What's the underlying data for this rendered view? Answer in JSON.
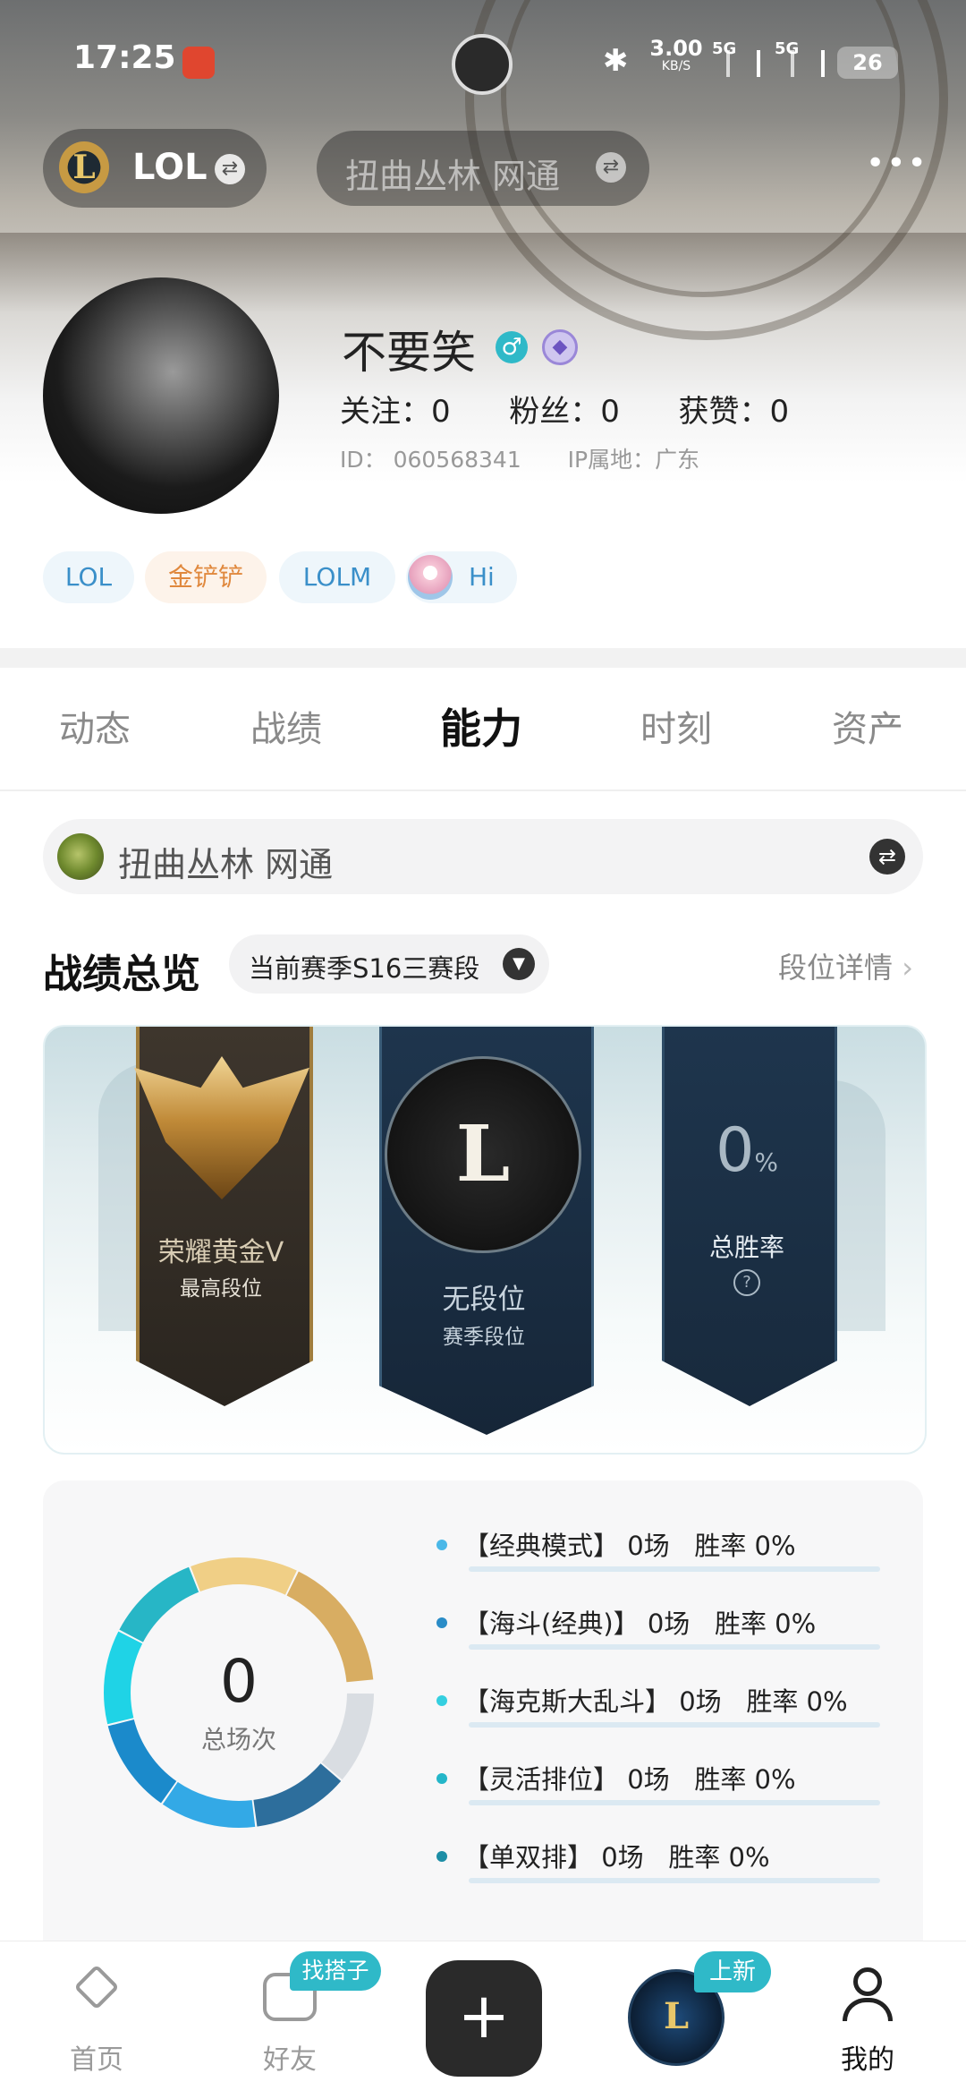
{
  "status": {
    "time": "17:25",
    "speed_value": "3.00",
    "speed_unit": "KB/S",
    "net1": "5G",
    "net2": "5G",
    "battery": "26"
  },
  "topbar": {
    "game": "LOL",
    "search_placeholder": "扭曲丛林 网通",
    "more": "•••"
  },
  "profile": {
    "name": "不要笑",
    "following_label": "关注：",
    "following": "0",
    "fans_label": "粉丝：",
    "fans": "0",
    "likes_label": "获赞：",
    "likes": "0",
    "id_label": "ID：",
    "id": "060568341",
    "ip_label": "IP属地：",
    "ip": "广东"
  },
  "tags": [
    "LOL",
    "金铲铲",
    "LOLM",
    "Hi"
  ],
  "tabs": [
    "动态",
    "战绩",
    "能力",
    "时刻",
    "资产"
  ],
  "active_tab": "能力",
  "server": {
    "name": "扭曲丛林 网通"
  },
  "overview": {
    "title": "战绩总览",
    "season": "当前赛季S16三赛段",
    "detail_link": "段位详情",
    "highest_rank": "荣耀黄金V",
    "highest_rank_label": "最高段位",
    "season_rank": "无段位",
    "season_rank_label": "赛季段位",
    "season_rank_emblem": "L",
    "winrate": "0",
    "winrate_unit": "%",
    "winrate_label": "总胜率",
    "help": "?"
  },
  "stats": {
    "total": "0",
    "total_label": "总场次",
    "modes": [
      {
        "name": "【经典模式】",
        "games": "0场",
        "winrate": "胜率 0%",
        "color": "#4bb8e8"
      },
      {
        "name": "【海斗(经典)】",
        "games": "0场",
        "winrate": "胜率 0%",
        "color": "#2a8cc7"
      },
      {
        "name": "【海克斯大乱斗】",
        "games": "0场",
        "winrate": "胜率 0%",
        "color": "#34cfe0"
      },
      {
        "name": "【灵活排位】",
        "games": "0场",
        "winrate": "胜率 0%",
        "color": "#24b6c9"
      },
      {
        "name": "【单双排】",
        "games": "0场",
        "winrate": "胜率 0%",
        "color": "#1d8ea6"
      }
    ]
  },
  "nav": {
    "home": "首页",
    "friends": "好友",
    "friends_badge": "找搭子",
    "new_badge": "上新",
    "me": "我的",
    "add": "+"
  },
  "colors": {
    "accent": "#2fb9c8",
    "ribbon_dark": "#1c2f44",
    "gold": "#c9a460"
  }
}
